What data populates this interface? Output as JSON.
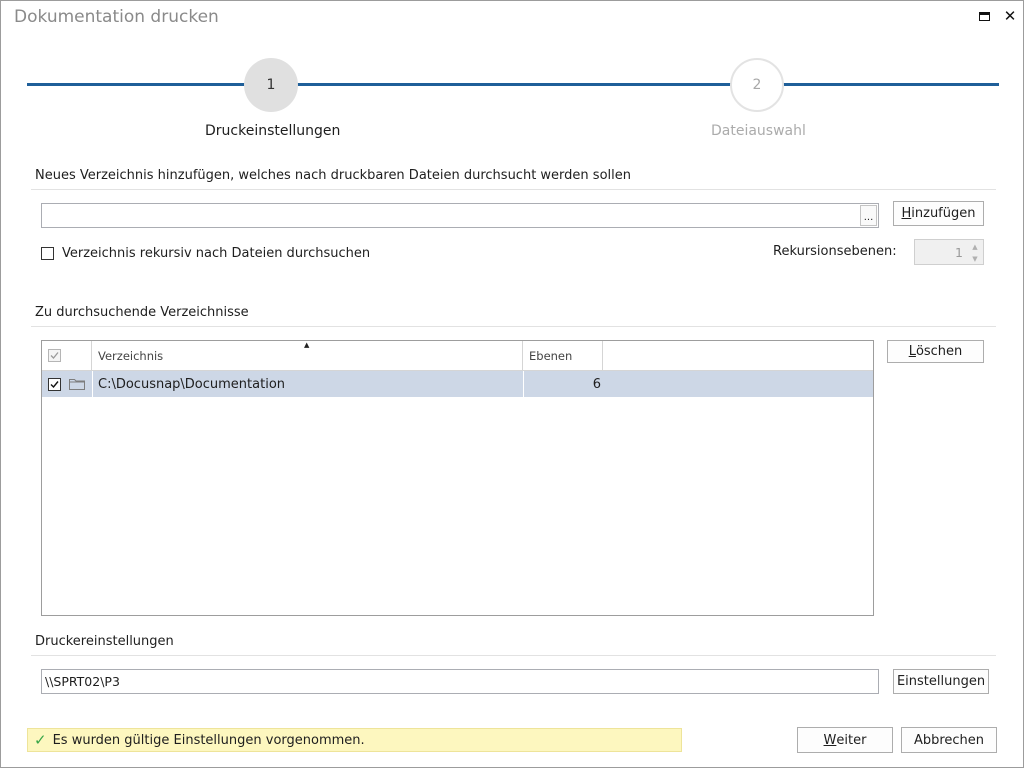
{
  "window": {
    "title": "Dokumentation drucken"
  },
  "wizard": {
    "steps": [
      {
        "number": "1",
        "label": "Druckeinstellungen",
        "active": true
      },
      {
        "number": "2",
        "label": "Dateiauswahl",
        "active": false
      }
    ]
  },
  "add_section": {
    "title": "Neues Verzeichnis hinzufügen, welches nach druckbaren Dateien durchsucht werden sollen",
    "path_value": "",
    "browse_label": "...",
    "add_button": {
      "mnemonic": "H",
      "rest": "inzufügen"
    },
    "recursive_label": "Verzeichnis rekursiv nach Dateien durchsuchen",
    "recursive_checked": false,
    "recursion_label": "Rekursionsebenen:",
    "recursion_value": "1"
  },
  "dirs_section": {
    "title": "Zu durchsuchende Verzeichnisse",
    "columns": [
      "Verzeichnis",
      "Ebenen"
    ],
    "rows": [
      {
        "checked": true,
        "path": "C:\\Docusnap\\Documentation",
        "levels": "6"
      }
    ],
    "delete_button": {
      "mnemonic": "L",
      "rest": "öschen"
    }
  },
  "printer_section": {
    "title": "Druckereinstellungen",
    "printer_value": "\\\\SPRT02\\P3",
    "settings_button": "Einstellungen"
  },
  "status": {
    "text": "Es wurden gültige Einstellungen vorgenommen."
  },
  "footer": {
    "next_button": {
      "mnemonic": "W",
      "rest": "eiter"
    },
    "cancel_button": "Abbrechen"
  },
  "colors": {
    "accent": "#1f5f99",
    "selected_row": "#cdd7e6",
    "status_bg": "#fdf7bf",
    "status_icon": "#3aa648"
  }
}
